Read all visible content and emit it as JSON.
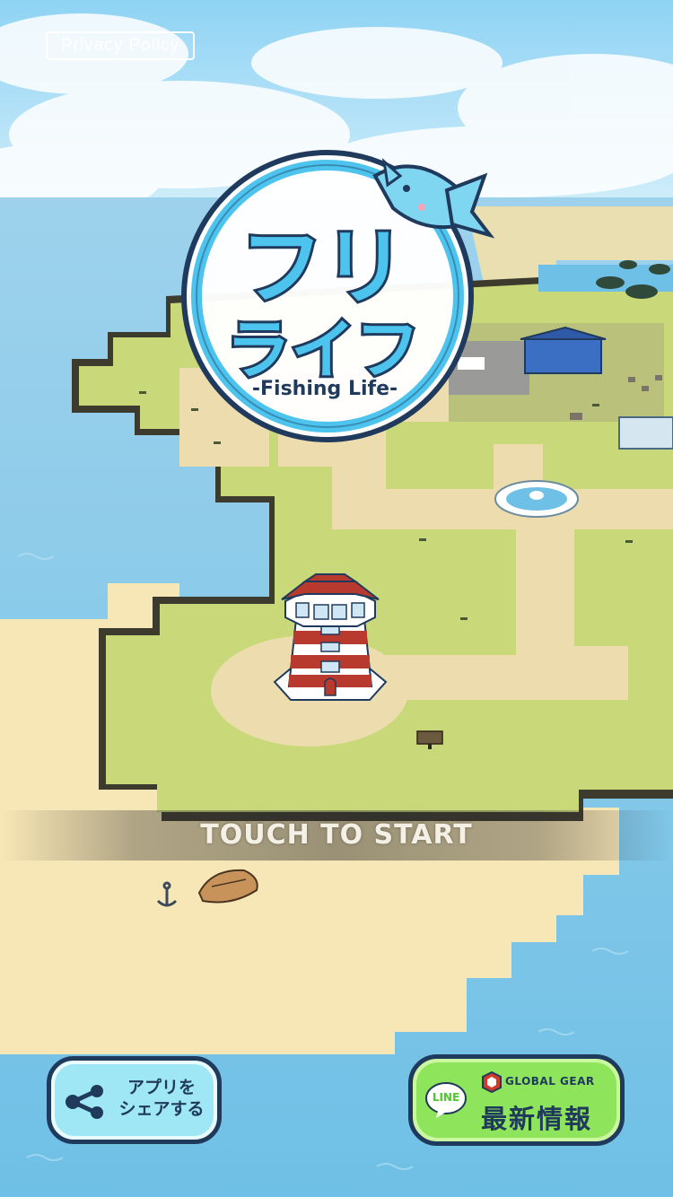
{
  "privacy_policy": {
    "label": "Privacy Policy"
  },
  "logo": {
    "title_line1": "フリ",
    "title_line2": "ライフ",
    "subtitle": "-Fishing Life-"
  },
  "touch_to_start": {
    "label": "TOUCH TO START"
  },
  "share_button": {
    "line1": "アプリを",
    "line2": "シェアする",
    "icon": "share-icon"
  },
  "news_button": {
    "line_label": "LINE",
    "brand": "GLOBAL GEAR",
    "title": "最新情報",
    "icons": [
      "line-icon",
      "global-gear-logo"
    ]
  },
  "colors": {
    "sky": "#bfe6f7",
    "sea": "#7ec8e8",
    "grass": "#c9d97a",
    "sand": "#f8e7b6",
    "logo_blue": "#4cc4ee",
    "dark_navy": "#1f3a5c"
  }
}
